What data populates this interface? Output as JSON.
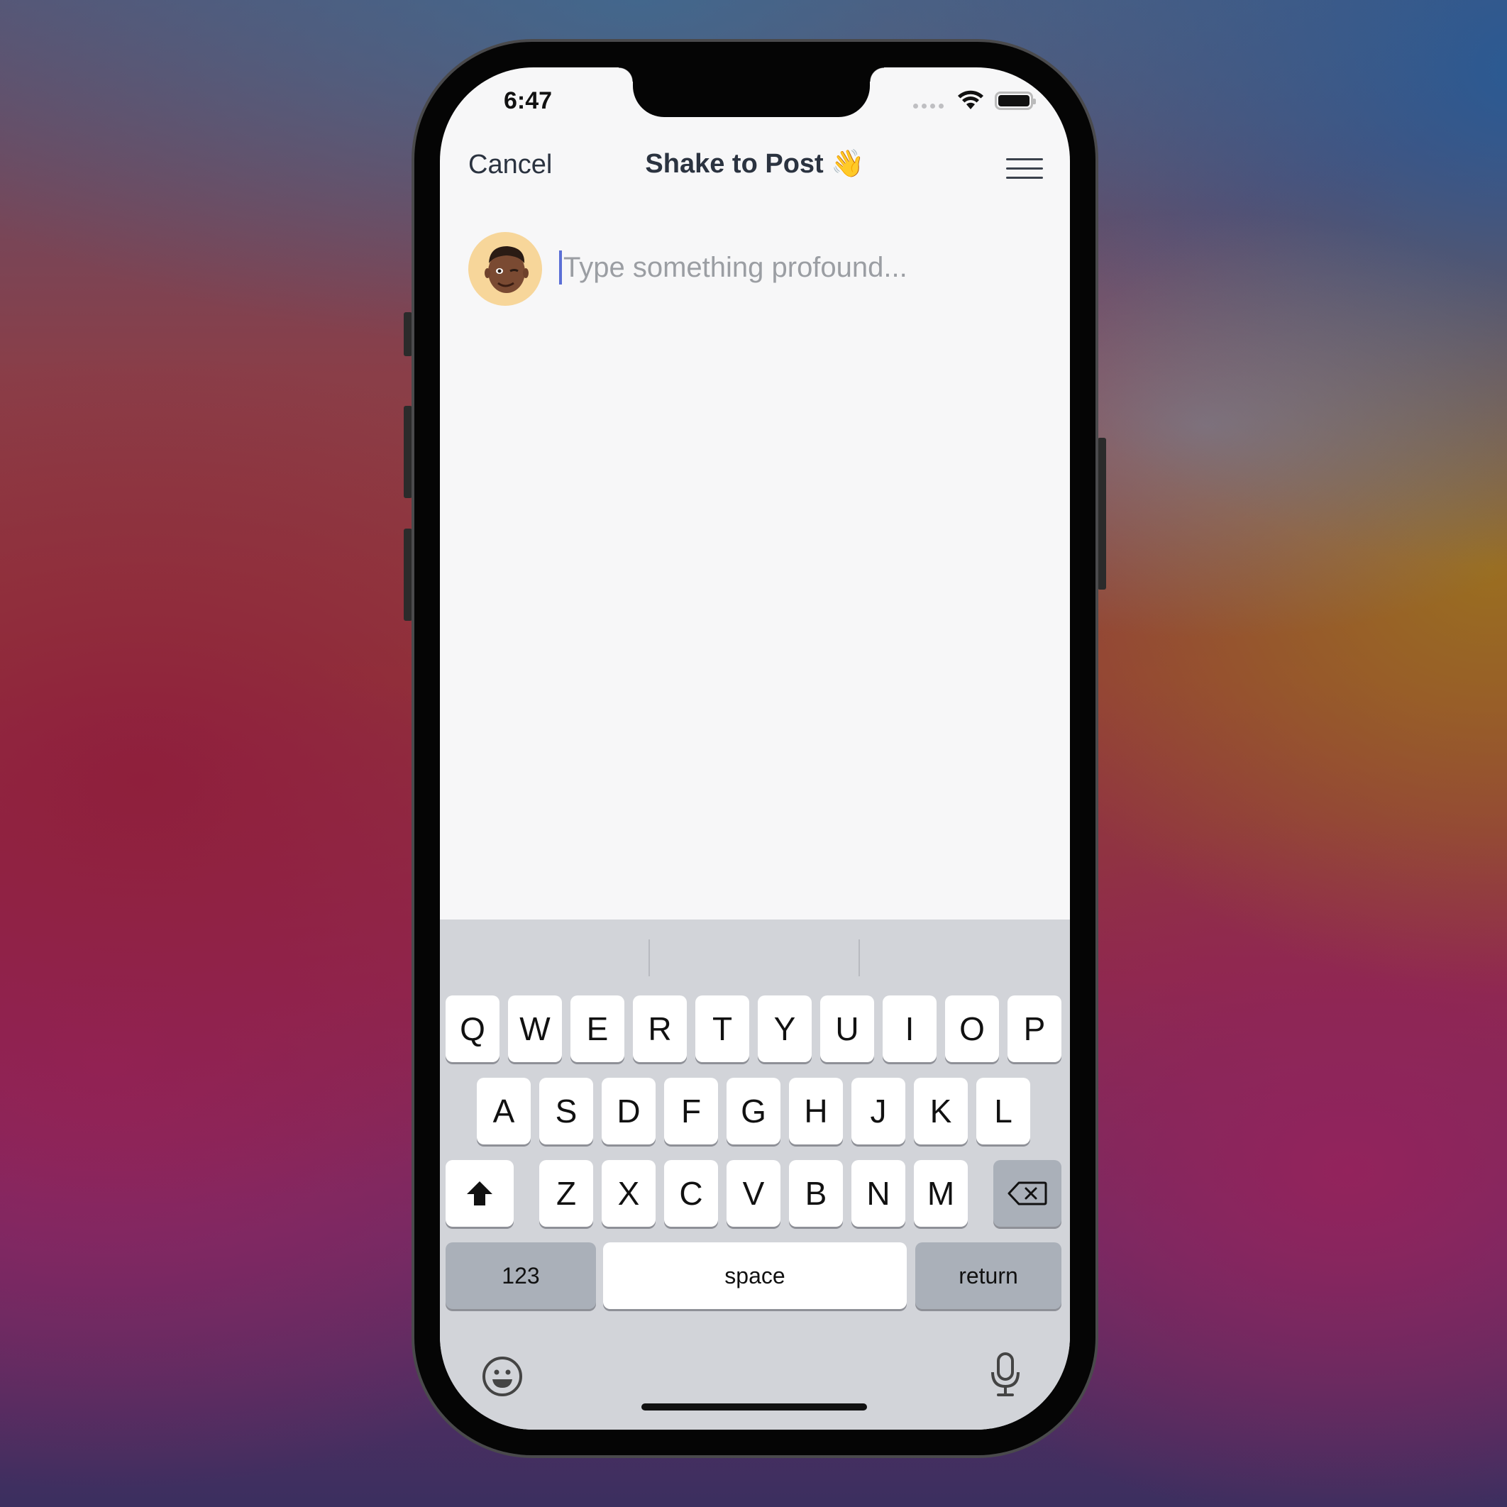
{
  "status_bar": {
    "time": "6:47"
  },
  "nav": {
    "cancel_label": "Cancel",
    "title": "Shake to Post 👋",
    "menu_icon": "hamburger-menu-icon"
  },
  "composer": {
    "placeholder": "Type something profound...",
    "value": ""
  },
  "keyboard": {
    "row1": [
      "Q",
      "W",
      "E",
      "R",
      "T",
      "Y",
      "U",
      "I",
      "O",
      "P"
    ],
    "row2": [
      "A",
      "S",
      "D",
      "F",
      "G",
      "H",
      "J",
      "K",
      "L"
    ],
    "row3": [
      "Z",
      "X",
      "C",
      "V",
      "B",
      "N",
      "M"
    ],
    "numbers_label": "123",
    "space_label": "space",
    "return_label": "return",
    "icons": [
      "shift-icon",
      "backspace-icon",
      "emoji-icon",
      "microphone-icon"
    ]
  },
  "colors": {
    "accent_caret": "#5b6fd6",
    "avatar_bg": "#f7d69a",
    "keyboard_bg": "#d2d4d9"
  }
}
